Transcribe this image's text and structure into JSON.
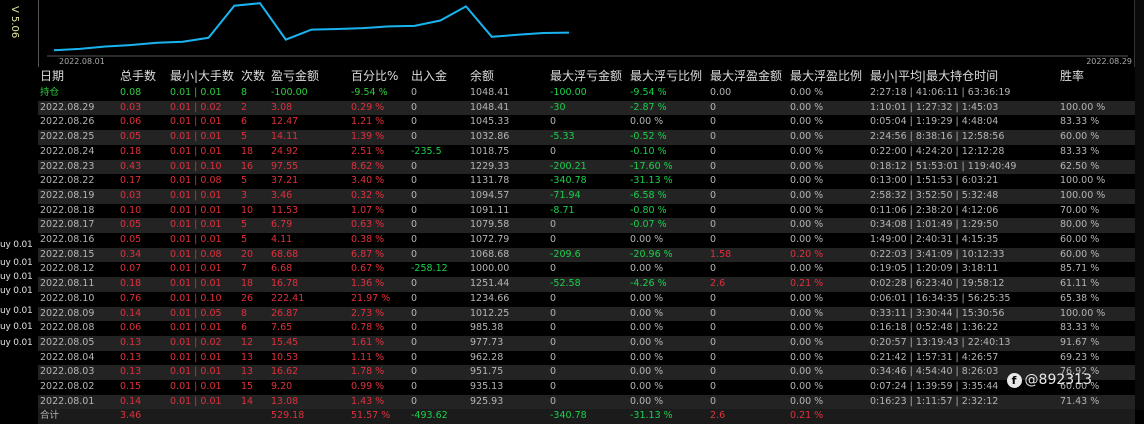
{
  "version_label": "V 5.06",
  "side_labels": [
    "uy 0.01",
    "uy 0.01",
    "uy 0.01",
    "uy 0.01",
    "uy 0.01",
    "uy 0.01",
    "uy 0.01"
  ],
  "chart": {
    "start_date": "2022.08.01",
    "end_date": "2022.08.29"
  },
  "headers": [
    "日期",
    "总手数",
    "最小|大手数",
    "次数",
    "盈亏金额",
    "百分比%",
    "出入金",
    "余额",
    "最大浮亏金额",
    "最大浮亏比例",
    "最大浮盈金额",
    "最大浮盈比例",
    "最小|平均|最大持仓时间",
    "胜率"
  ],
  "holding": {
    "label": "持仓",
    "lots": "0.08",
    "minmax": "0.01 | 0.01",
    "count": "8",
    "pnl": "-100.00",
    "pct": "-9.54 %",
    "flow": "0",
    "balance": "1048.41",
    "max_float_loss": "-100.00",
    "max_float_loss_pct": "-9.54 %",
    "max_float_profit": "0.00",
    "max_float_profit_pct": "0.00 %",
    "hold_time": "2:27:18 | 41:06:11 | 63:36:19",
    "win_rate": ""
  },
  "rows": [
    {
      "date": "2022.08.29",
      "lots": "0.03",
      "minmax": "0.01 | 0.02",
      "count": "2",
      "pnl": "3.08",
      "pct": "0.29 %",
      "flow": "0",
      "balance": "1048.41",
      "mfl": "-30",
      "mflp": "-2.87 %",
      "mfp": "0",
      "mfpp": "0.00 %",
      "hold": "1:10:01 | 1:27:32 | 1:45:03",
      "win": "100.00 %"
    },
    {
      "date": "2022.08.26",
      "lots": "0.06",
      "minmax": "0.01 | 0.01",
      "count": "6",
      "pnl": "12.47",
      "pct": "1.21 %",
      "flow": "0",
      "balance": "1045.33",
      "mfl": "0",
      "mflp": "0.00 %",
      "mfp": "0",
      "mfpp": "0.00 %",
      "hold": "0:05:04 | 1:19:29 | 4:48:04",
      "win": "83.33 %"
    },
    {
      "date": "2022.08.25",
      "lots": "0.05",
      "minmax": "0.01 | 0.01",
      "count": "5",
      "pnl": "14.11",
      "pct": "1.39 %",
      "flow": "0",
      "balance": "1032.86",
      "mfl": "-5.33",
      "mflp": "-0.52 %",
      "mfp": "0",
      "mfpp": "0.00 %",
      "hold": "2:24:56 | 8:38:16 | 12:58:56",
      "win": "60.00 %"
    },
    {
      "date": "2022.08.24",
      "lots": "0.18",
      "minmax": "0.01 | 0.01",
      "count": "18",
      "pnl": "24.92",
      "pct": "2.51 %",
      "flow": "-235.5",
      "balance": "1018.75",
      "mfl": "0",
      "mflp": "-0.10 %",
      "mfp": "0",
      "mfpp": "0.00 %",
      "hold": "0:22:00 | 4:24:20 | 12:12:28",
      "win": "83.33 %"
    },
    {
      "date": "2022.08.23",
      "lots": "0.43",
      "minmax": "0.01 | 0.10",
      "count": "16",
      "pnl": "97.55",
      "pct": "8.62 %",
      "flow": "0",
      "balance": "1229.33",
      "mfl": "-200.21",
      "mflp": "-17.60 %",
      "mfp": "0",
      "mfpp": "0.00 %",
      "hold": "0:18:12 | 51:53:01 | 119:40:49",
      "win": "62.50 %"
    },
    {
      "date": "2022.08.22",
      "lots": "0.17",
      "minmax": "0.01 | 0.08",
      "count": "5",
      "pnl": "37.21",
      "pct": "3.40 %",
      "flow": "0",
      "balance": "1131.78",
      "mfl": "-340.78",
      "mflp": "-31.13 %",
      "mfp": "0",
      "mfpp": "0.00 %",
      "hold": "0:13:00 | 1:51:53 | 6:03:21",
      "win": "100.00 %"
    },
    {
      "date": "2022.08.19",
      "lots": "0.03",
      "minmax": "0.01 | 0.01",
      "count": "3",
      "pnl": "3.46",
      "pct": "0.32 %",
      "flow": "0",
      "balance": "1094.57",
      "mfl": "-71.94",
      "mflp": "-6.58 %",
      "mfp": "0",
      "mfpp": "0.00 %",
      "hold": "2:58:32 | 3:52:50 | 5:32:48",
      "win": "100.00 %"
    },
    {
      "date": "2022.08.18",
      "lots": "0.10",
      "minmax": "0.01 | 0.01",
      "count": "10",
      "pnl": "11.53",
      "pct": "1.07 %",
      "flow": "0",
      "balance": "1091.11",
      "mfl": "-8.71",
      "mflp": "-0.80 %",
      "mfp": "0",
      "mfpp": "0.00 %",
      "hold": "0:11:06 | 2:38:20 | 4:12:06",
      "win": "70.00 %"
    },
    {
      "date": "2022.08.17",
      "lots": "0.05",
      "minmax": "0.01 | 0.01",
      "count": "5",
      "pnl": "6.79",
      "pct": "0.63 %",
      "flow": "0",
      "balance": "1079.58",
      "mfl": "0",
      "mflp": "-0.07 %",
      "mfp": "0",
      "mfpp": "0.00 %",
      "hold": "0:34:08 | 1:01:49 | 1:29:50",
      "win": "80.00 %"
    },
    {
      "date": "2022.08.16",
      "lots": "0.05",
      "minmax": "0.01 | 0.01",
      "count": "5",
      "pnl": "4.11",
      "pct": "0.38 %",
      "flow": "0",
      "balance": "1072.79",
      "mfl": "0",
      "mflp": "0.00 %",
      "mfp": "0",
      "mfpp": "0.00 %",
      "hold": "1:49:00 | 2:40:31 | 4:15:35",
      "win": "60.00 %"
    },
    {
      "date": "2022.08.15",
      "lots": "0.34",
      "minmax": "0.01 | 0.08",
      "count": "20",
      "pnl": "68.68",
      "pct": "6.87 %",
      "flow": "0",
      "balance": "1068.68",
      "mfl": "-209.6",
      "mflp": "-20.96 %",
      "mfp": "1.58",
      "mfpp": "0.20 %",
      "hold": "0:22:03 | 3:41:09 | 10:12:33",
      "win": "60.00 %"
    },
    {
      "date": "2022.08.12",
      "lots": "0.07",
      "minmax": "0.01 | 0.01",
      "count": "7",
      "pnl": "6.68",
      "pct": "0.67 %",
      "flow": "-258.12",
      "balance": "1000.00",
      "mfl": "0",
      "mflp": "0.00 %",
      "mfp": "0",
      "mfpp": "0.00 %",
      "hold": "0:19:05 | 1:20:09 | 3:18:11",
      "win": "85.71 %"
    },
    {
      "date": "2022.08.11",
      "lots": "0.18",
      "minmax": "0.01 | 0.01",
      "count": "18",
      "pnl": "16.78",
      "pct": "1.36 %",
      "flow": "0",
      "balance": "1251.44",
      "mfl": "-52.58",
      "mflp": "-4.26 %",
      "mfp": "2.6",
      "mfpp": "0.21 %",
      "hold": "0:02:28 | 6:23:40 | 19:58:12",
      "win": "61.11 %"
    },
    {
      "date": "2022.08.10",
      "lots": "0.76",
      "minmax": "0.01 | 0.10",
      "count": "26",
      "pnl": "222.41",
      "pct": "21.97 %",
      "flow": "0",
      "balance": "1234.66",
      "mfl": "0",
      "mflp": "0.00 %",
      "mfp": "0",
      "mfpp": "0.00 %",
      "hold": "0:06:01 | 16:34:35 | 56:25:35",
      "win": "65.38 %"
    },
    {
      "date": "2022.08.09",
      "lots": "0.14",
      "minmax": "0.01 | 0.05",
      "count": "8",
      "pnl": "26.87",
      "pct": "2.73 %",
      "flow": "0",
      "balance": "1012.25",
      "mfl": "0",
      "mflp": "0.00 %",
      "mfp": "0",
      "mfpp": "0.00 %",
      "hold": "0:33:11 | 3:30:44 | 15:30:56",
      "win": "100.00 %"
    },
    {
      "date": "2022.08.08",
      "lots": "0.06",
      "minmax": "0.01 | 0.01",
      "count": "6",
      "pnl": "7.65",
      "pct": "0.78 %",
      "flow": "0",
      "balance": "985.38",
      "mfl": "0",
      "mflp": "0.00 %",
      "mfp": "0",
      "mfpp": "0.00 %",
      "hold": "0:16:18 | 0:52:48 | 1:36:22",
      "win": "83.33 %"
    },
    {
      "date": "2022.08.05",
      "lots": "0.13",
      "minmax": "0.01 | 0.02",
      "count": "12",
      "pnl": "15.45",
      "pct": "1.61 %",
      "flow": "0",
      "balance": "977.73",
      "mfl": "0",
      "mflp": "0.00 %",
      "mfp": "0",
      "mfpp": "0.00 %",
      "hold": "0:20:57 | 13:19:43 | 22:40:13",
      "win": "91.67 %"
    },
    {
      "date": "2022.08.04",
      "lots": "0.13",
      "minmax": "0.01 | 0.01",
      "count": "13",
      "pnl": "10.53",
      "pct": "1.11 %",
      "flow": "0",
      "balance": "962.28",
      "mfl": "0",
      "mflp": "0.00 %",
      "mfp": "0",
      "mfpp": "0.00 %",
      "hold": "0:21:42 | 1:57:31 | 4:26:57",
      "win": "69.23 %"
    },
    {
      "date": "2022.08.03",
      "lots": "0.13",
      "minmax": "0.01 | 0.01",
      "count": "13",
      "pnl": "16.62",
      "pct": "1.78 %",
      "flow": "0",
      "balance": "951.75",
      "mfl": "0",
      "mflp": "0.00 %",
      "mfp": "0",
      "mfpp": "0.00 %",
      "hold": "0:34:46 | 4:54:40 | 8:26:03",
      "win": "76.92 %"
    },
    {
      "date": "2022.08.02",
      "lots": "0.15",
      "minmax": "0.01 | 0.01",
      "count": "15",
      "pnl": "9.20",
      "pct": "0.99 %",
      "flow": "0",
      "balance": "935.13",
      "mfl": "0",
      "mflp": "0.00 %",
      "mfp": "0",
      "mfpp": "0.00 %",
      "hold": "0:07:24 | 1:39:59 | 3:35:44",
      "win": "60.00 %"
    },
    {
      "date": "2022.08.01",
      "lots": "0.14",
      "minmax": "0.01 | 0.01",
      "count": "14",
      "pnl": "13.08",
      "pct": "1.43 %",
      "flow": "0",
      "balance": "925.93",
      "mfl": "0",
      "mflp": "0.00 %",
      "mfp": "0",
      "mfpp": "0.00 %",
      "hold": "0:16:23 | 1:11:57 | 2:32:12",
      "win": "71.43 %"
    }
  ],
  "total": {
    "label": "合计",
    "lots": "3.46",
    "pnl": "529.18",
    "pct": "51.57 %",
    "flow": "-493.62",
    "mfl": "-340.78",
    "mflp": "-31.13 %",
    "mfp": "2.6",
    "mfpp": "0.21 %"
  },
  "watermark": "@892313",
  "colors": {
    "loss": "#e0303c",
    "gain": "#19d04c",
    "neutral": "#b4b4b4",
    "curve": "#19b4f0"
  }
}
